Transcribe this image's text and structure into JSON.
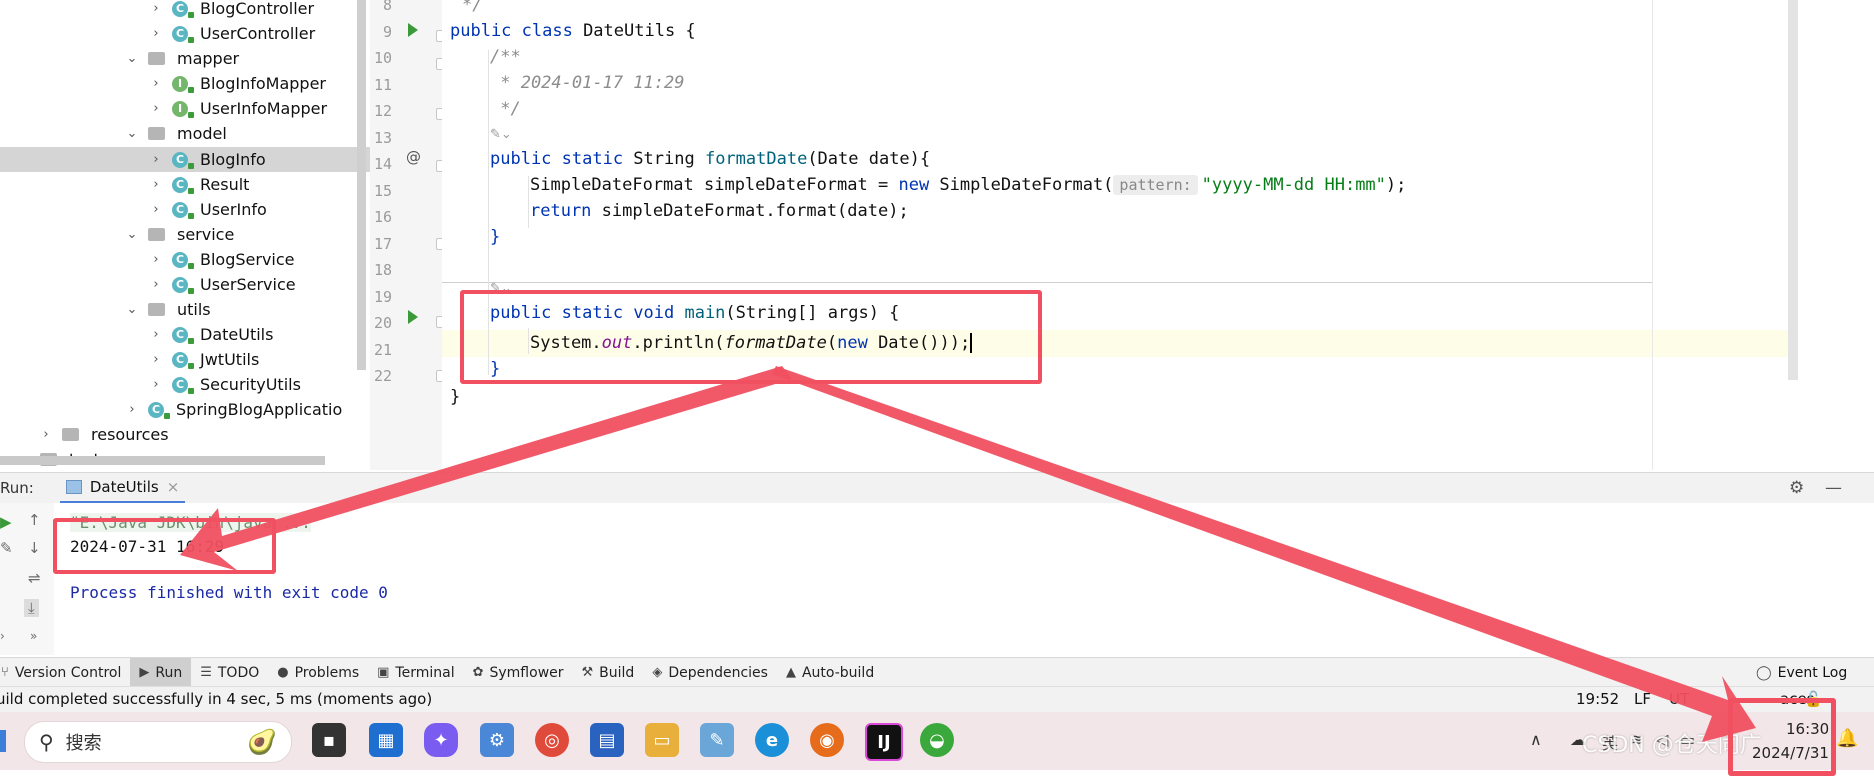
{
  "project_tree": {
    "items": [
      {
        "label": "BlogController",
        "kind": "class",
        "chevron": "›",
        "level": 3
      },
      {
        "label": "UserController",
        "kind": "class",
        "chevron": "›",
        "level": 3
      },
      {
        "label": "mapper",
        "kind": "folder",
        "chevron": "⌄",
        "level": 2
      },
      {
        "label": "BlogInfoMapper",
        "kind": "interface",
        "chevron": "›",
        "level": 3
      },
      {
        "label": "UserInfoMapper",
        "kind": "interface",
        "chevron": "›",
        "level": 3
      },
      {
        "label": "model",
        "kind": "folder",
        "chevron": "⌄",
        "level": 2
      },
      {
        "label": "BlogInfo",
        "kind": "class",
        "chevron": "›",
        "level": 3,
        "selected": true
      },
      {
        "label": "Result",
        "kind": "class",
        "chevron": "›",
        "level": 3
      },
      {
        "label": "UserInfo",
        "kind": "class",
        "chevron": "›",
        "level": 3
      },
      {
        "label": "service",
        "kind": "folder",
        "chevron": "⌄",
        "level": 2
      },
      {
        "label": "BlogService",
        "kind": "class",
        "chevron": "›",
        "level": 3
      },
      {
        "label": "UserService",
        "kind": "class",
        "chevron": "›",
        "level": 3
      },
      {
        "label": "utils",
        "kind": "folder",
        "chevron": "⌄",
        "level": 2
      },
      {
        "label": "DateUtils",
        "kind": "class",
        "chevron": "›",
        "level": 3
      },
      {
        "label": "JwtUtils",
        "kind": "class",
        "chevron": "›",
        "level": 3
      },
      {
        "label": "SecurityUtils",
        "kind": "class",
        "chevron": "›",
        "level": 3
      },
      {
        "label": "SpringBlogApplicatio",
        "kind": "class",
        "chevron": "›",
        "level": 1
      },
      {
        "label": "resources",
        "kind": "folder",
        "chevron": "›",
        "level": 0
      },
      {
        "label": "test",
        "kind": "folder",
        "chevron": "›",
        "level": -1
      }
    ]
  },
  "editor": {
    "line_numbers": [
      "8",
      "9",
      "10",
      "11",
      "12",
      "13",
      "14",
      "15",
      "16",
      "17",
      "18",
      "19",
      "20",
      "21",
      "22"
    ],
    "line8": "*/",
    "l9_kw": "public class",
    "l9_name": " DateUtils ",
    "l9_brace": "{",
    "l10": "/**",
    "l11": " * 2024-01-17 11:29",
    "l12": " */",
    "l13_kw": "public static",
    "l13_type": " String ",
    "l13_fn": "formatDate",
    "l13_rest": "(Date date){",
    "l14_a": "SimpleDateFormat simpleDateFormat = ",
    "l14_kw": "new",
    "l14_b": " SimpleDateFormat(",
    "l14_hint": "pattern:",
    "l14_str": "\"yyyy-MM-dd HH:mm\"",
    "l14_end": ");",
    "l15_kw": "return",
    "l15_rest": " simpleDateFormat.format(date);",
    "l16": "}",
    "l18_kw": "public static void",
    "l18_fn": " main",
    "l18_rest": "(String[] args) {",
    "l19_a": "System.",
    "l19_field": "out",
    "l19_b": ".println(",
    "l19_fn": "formatDate",
    "l19_c": "(",
    "l19_kw": "new",
    "l19_d": " Date()));",
    "l20": "}",
    "l21": "}"
  },
  "run_panel": {
    "label": "Run:",
    "tab": "DateUtils",
    "tab_close": "×",
    "console": {
      "command": "\"E:\\Java JDK\\bin\\java ...",
      "output": "2024-07-31 16:29",
      "exit": "Process finished with exit code 0"
    }
  },
  "tool_windows": [
    {
      "label": "Version Control",
      "icon": "branch-icon",
      "glyph": "⑂"
    },
    {
      "label": "Run",
      "icon": "run-icon",
      "glyph": "▶",
      "active": true
    },
    {
      "label": "TODO",
      "icon": "todo-icon",
      "glyph": "☰"
    },
    {
      "label": "Problems",
      "icon": "problems-icon",
      "glyph": "●"
    },
    {
      "label": "Terminal",
      "icon": "terminal-icon",
      "glyph": "▣"
    },
    {
      "label": "Symflower",
      "icon": "symflower-icon",
      "glyph": "✿"
    },
    {
      "label": "Build",
      "icon": "build-icon",
      "glyph": "⚒"
    },
    {
      "label": "Dependencies",
      "icon": "dependencies-icon",
      "glyph": "◈"
    },
    {
      "label": "Auto-build",
      "icon": "warning-icon",
      "glyph": "▲"
    }
  ],
  "event_log": "Event Log",
  "status_bar": {
    "message": "uild completed successfully in 4 sec, 5 ms (moments ago)",
    "time": "19:52",
    "lf": "LF",
    "encoding": "UT",
    "indent": "aces"
  },
  "taskbar": {
    "search_placeholder": "搜索",
    "tray_ime": "英",
    "clock_time": "16:30",
    "clock_date": "2024/7/31",
    "watermark": "CSDN @仓天同广"
  },
  "colors": {
    "highlight": "#f05060",
    "keyword": "#0033b3",
    "string": "#067d17",
    "function": "#00627a",
    "field": "#871094"
  }
}
